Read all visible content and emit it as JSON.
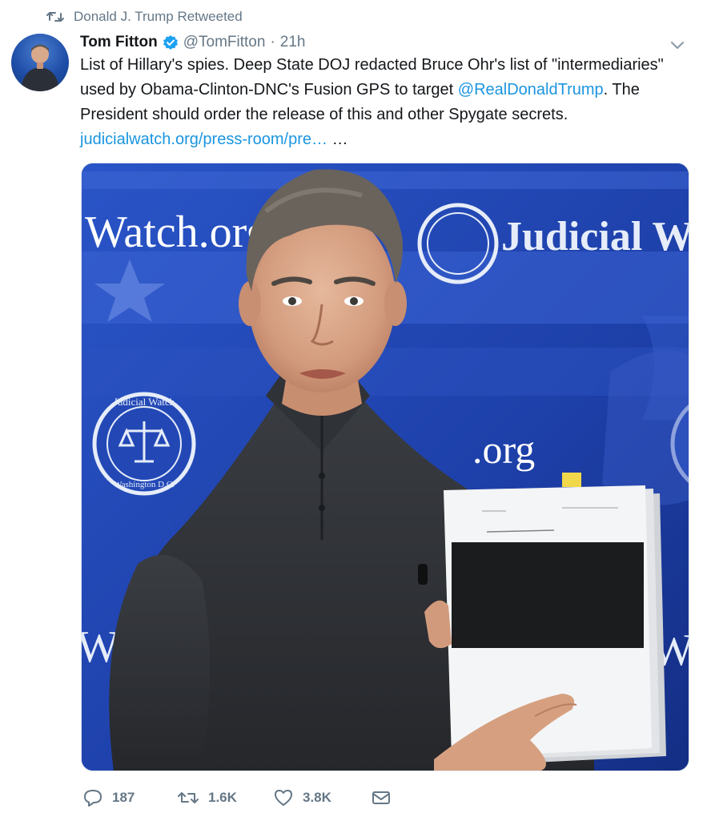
{
  "context": {
    "icon": "retweet-icon",
    "text": "Donald J. Trump Retweeted"
  },
  "author": {
    "name": "Tom Fitton",
    "verified": true,
    "handle": "@TomFitton",
    "separator": "·",
    "time": "21h"
  },
  "tweet": {
    "text_1": "List of Hillary's spies. Deep State DOJ redacted Bruce Ohr's list of \"intermediaries\" used by Obama-Clinton-DNC's Fusion GPS to target ",
    "mention": "@RealDonaldTrump",
    "text_2": ".  The President should order the release of this and other Spygate secrets. ",
    "link": "judicialwatch.org/press-room/pre…",
    "ellipsis": " …"
  },
  "media": {
    "banner_left": "Watch.org",
    "banner_right": "Judicial W",
    "seal_top": "Judicial Watch",
    "seal_bottom": "Washington D.C.",
    "lower_text": ".org",
    "bottom_left": "W",
    "bottom_right": "W"
  },
  "actions": {
    "reply_count": "187",
    "retweet_count": "1.6K",
    "like_count": "3.8K"
  },
  "colors": {
    "link": "#1b95e0",
    "muted": "#657786",
    "backdrop_blue": "#1e3fae"
  }
}
